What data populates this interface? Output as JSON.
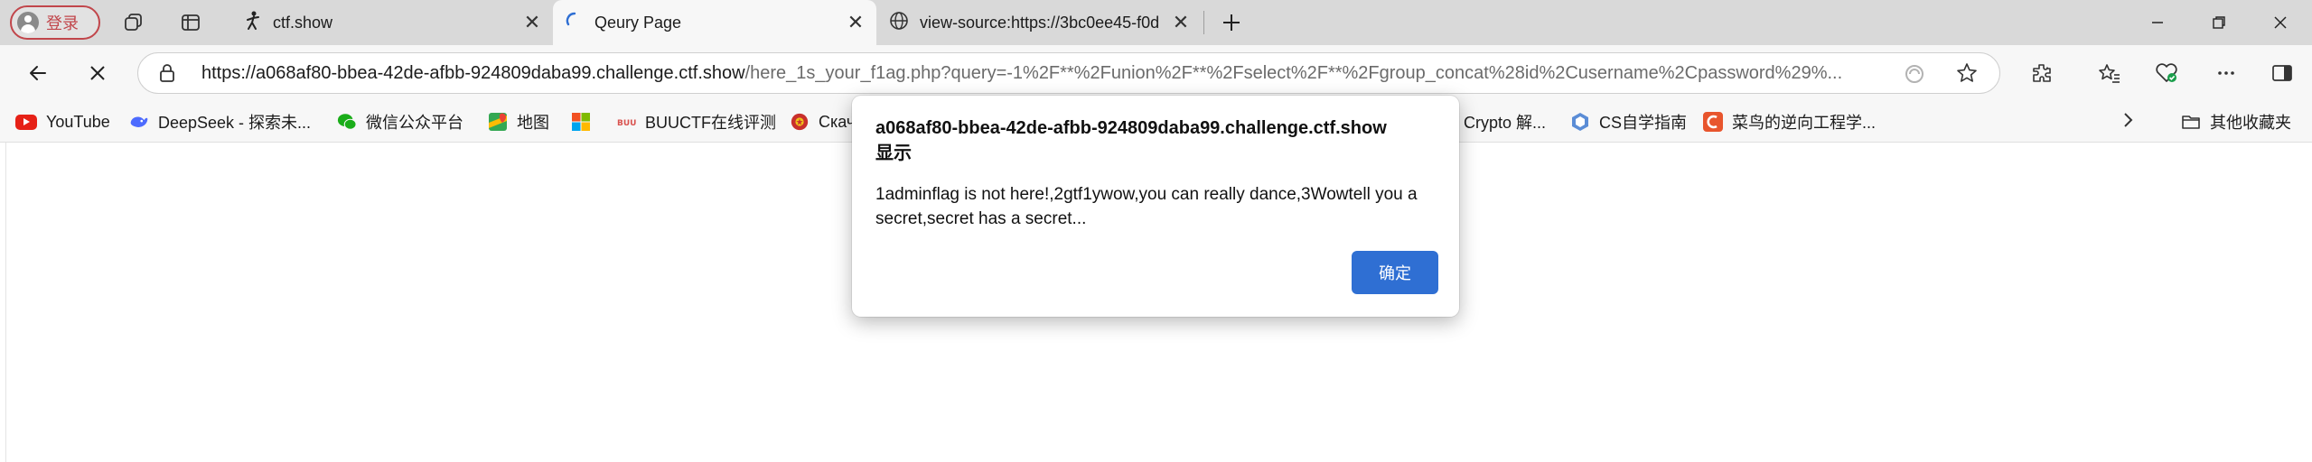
{
  "profile": {
    "label": "登录",
    "icon": "person-icon"
  },
  "tabs": [
    {
      "title": "ctf.show",
      "icon": "stick-figure-icon",
      "active": false
    },
    {
      "title": "Qeury Page",
      "icon": "loading-spinner-icon",
      "active": true
    },
    {
      "title": "view-source:https://3bc0ee45-f0d",
      "icon": "globe-icon",
      "active": false
    }
  ],
  "toolbar": {
    "url_host": "https://a068af80-bbea-42de-afbb-924809daba99.challenge.ctf.show",
    "url_path": "/here_1s_your_f1ag.php?query=-1%2F**%2Funion%2F**%2Fselect%2F**%2Fgroup_concat%28id%2Cusername%2Cpassword%29%..."
  },
  "bookmarks": [
    {
      "label": "YouTube",
      "icon": "youtube-icon",
      "color": "#e62117"
    },
    {
      "label": "DeepSeek - 探索未...",
      "icon": "deepseek-icon",
      "color": "#4d6bfe"
    },
    {
      "label": "微信公众平台",
      "icon": "wechat-icon",
      "color": "#1aad19"
    },
    {
      "label": "地图",
      "icon": "maps-icon",
      "color": "#34a853"
    },
    {
      "label": "",
      "icon": "microsoft-icon",
      "color": "#f25022"
    },
    {
      "label": "BUUCTF在线评测",
      "icon": "buuctf-icon",
      "color": "#d9534f"
    },
    {
      "label": "Скач",
      "icon": "emblem-icon",
      "color": "#c9302c"
    },
    {
      "label": "Crypto 解...",
      "icon": "",
      "color": ""
    },
    {
      "label": "CS自学指南",
      "icon": "cs-guide-icon",
      "color": "#5b8dd6"
    },
    {
      "label": "菜鸟的逆向工程学...",
      "icon": "csdn-icon",
      "color": "#e8552d"
    }
  ],
  "other_bookmarks": "其他收藏夹",
  "dialog": {
    "title_host": "a068af80-bbea-42de-afbb-924809daba99.challenge.ctf.show",
    "title_suffix": "显示",
    "message": "1adminflag is not here!,2gtf1ywow,you can really dance,3Wowtell you a secret,secret has a secret...",
    "ok_label": "确定"
  }
}
